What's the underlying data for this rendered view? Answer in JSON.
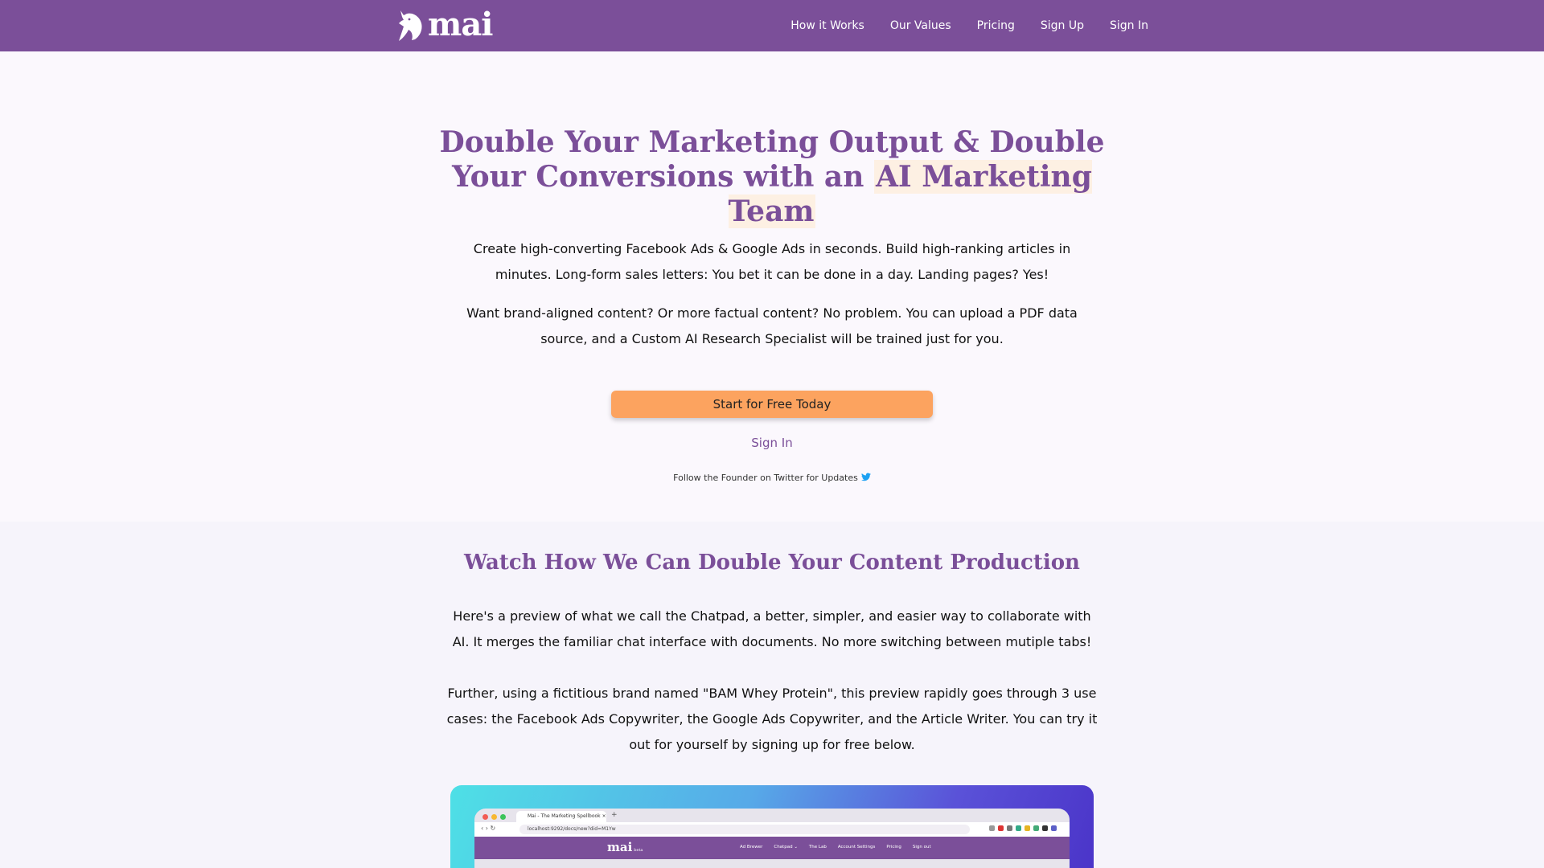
{
  "nav": {
    "logo_text": "mai",
    "links": [
      "How it Works",
      "Our Values",
      "Pricing",
      "Sign Up",
      "Sign In"
    ]
  },
  "hero": {
    "headline_part1": "Double Your Marketing Output & Double Your Conversions with an ",
    "headline_highlight": "AI Marketing Team",
    "para1": "Create high-converting Facebook Ads & Google Ads in seconds. Build high-ranking articles in minutes. Long-form sales letters: You bet it can be done in a day. Landing pages? Yes!",
    "para2": "Want brand-aligned content? Or more factual content? No problem. You can upload a PDF data source, and a Custom AI Research Specialist will be trained just for you.",
    "cta_label": "Start for Free Today",
    "signin_label": "Sign In",
    "follow_text": "Follow the Founder on Twitter for Updates"
  },
  "watch": {
    "heading": "Watch How We Can Double Your Content Production",
    "para1": "Here's a preview of what we call the Chatpad, a better, simpler, and easier way to collaborate with AI. It merges the familiar chat interface with documents. No more switching between mutiple tabs!",
    "para2": "Further, using a fictitious brand named \"BAM Whey Protein\", this preview rapidly goes through 3 use cases: the Facebook Ads Copywriter, the Google Ads Copywriter, and the Article Writer. You can try it out for yourself by signing up for free below."
  },
  "preview": {
    "tab_title": "Mai - The Marketing Spellbook",
    "url": "localhost:9292/docs/new?did=M1Yw",
    "logo_text": "mai",
    "logo_badge": "beta",
    "nav_items": [
      "Ad Brewer",
      "Chatpad ⌄",
      "The Lab",
      "Account Settings",
      "Pricing",
      "Sign out"
    ]
  },
  "colors": {
    "brand_purple": "#7b4f99",
    "cta_orange": "#fca35f",
    "highlight_bg": "#fdf0e3",
    "twitter_blue": "#1da1f2"
  },
  "icons": {
    "logo": "horse-head-logo-icon",
    "twitter": "twitter-bird-icon"
  }
}
